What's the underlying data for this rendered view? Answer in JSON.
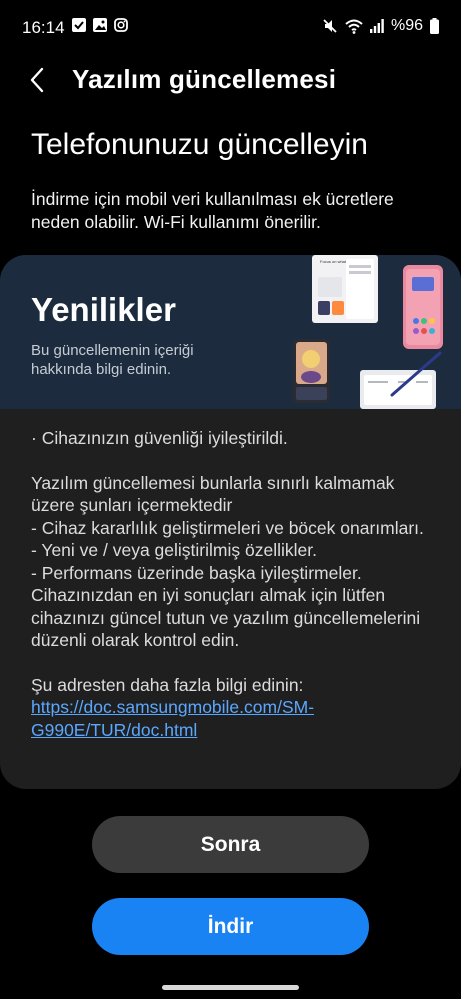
{
  "status_bar": {
    "time": "16:14",
    "left_icons": [
      "check-notification-icon",
      "gallery-notification-icon",
      "instagram-notification-icon"
    ],
    "right_icons": [
      "mute-icon",
      "wifi-icon",
      "signal-icon"
    ],
    "battery_text": "%96"
  },
  "header": {
    "back_icon": "chevron-left-icon",
    "title": "Yazılım güncellemesi"
  },
  "main": {
    "heading": "Telefonunuzu güncelleyin",
    "info": "İndirme için mobil veri kullanılması ek ücretlere neden olabilir. Wi-Fi kullanımı önerilir."
  },
  "banner": {
    "title": "Yenilikler",
    "subtitle": "Bu güncellemenin içeriği hakkında bilgi edinin.",
    "art_tablet_text": "Focus on what matters"
  },
  "notes": {
    "line1": "· Cihazınızın güvenliği iyileştirildi.",
    "paragraph": "Yazılım güncellemesi bunlarla sınırlı kalmamak üzere şunları içermektedir\n - Cihaz kararlılık geliştirmeleri ve böcek onarımları.\n - Yeni ve / veya geliştirilmiş özellikler.\n - Performans üzerinde başka iyileştirmeler.\nCihazınızdan en iyi sonuçları almak için lütfen cihazınızı güncel tutun ve yazılım güncellemelerini düzenli olarak kontrol edin.",
    "more_info": "Şu adresten daha fazla bilgi edinin:",
    "link": "https://doc.samsungmobile.com/SM-G990E/TUR/doc.html"
  },
  "buttons": {
    "later": "Sonra",
    "download": "İndir"
  },
  "colors": {
    "background": "#000000",
    "card": "#1f1f1f",
    "banner": "#1c2c3e",
    "accent": "#1a83f4",
    "link": "#5aa7ff",
    "secondary_button": "#3b3b3b"
  }
}
